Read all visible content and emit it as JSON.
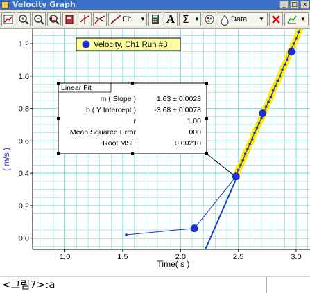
{
  "window": {
    "title": "Velocity Graph"
  },
  "toolbar": {
    "fit_label": "Fit",
    "data_label": "Data",
    "text_tool_label": "A",
    "stats_label": "Σ"
  },
  "legend": {
    "label": "Velocity, Ch1 Run #3"
  },
  "fit_box": {
    "title": "Linear Fit",
    "rows": [
      {
        "label": "m ( Slope )",
        "value": "1.63 ± 0.0028"
      },
      {
        "label": "b ( Y Intercept )",
        "value": "-3.68 ± 0.0078"
      },
      {
        "label": "r",
        "value": "1.00"
      },
      {
        "label": "Mean Squared Error",
        "value": "000"
      },
      {
        "label": "Root MSE",
        "value": "0.00210"
      }
    ]
  },
  "caption": "<그림7>:a",
  "colors": {
    "grid": "#7fe0e0",
    "series": "#1f2fd6",
    "fit_line": "#1a3bd0",
    "highlight": "#ffee00"
  },
  "chart_data": {
    "type": "scatter",
    "title": "",
    "xlabel": "Time( s )",
    "ylabel": "( m/s )",
    "xlim": [
      0.72,
      3.12
    ],
    "ylim": [
      -0.07,
      1.29
    ],
    "xticks": [
      "1.0",
      "1.5",
      "2.0",
      "2.5",
      "3.0"
    ],
    "yticks": [
      "0.0",
      "0.2",
      "0.4",
      "0.6",
      "0.8",
      "1.0",
      "1.2"
    ],
    "grid": true,
    "legend_position": "top-center",
    "series": [
      {
        "name": "Velocity, Ch1 Run #3",
        "x": [
          1.53,
          2.12,
          2.48,
          2.5,
          2.52,
          2.54,
          2.56,
          2.58,
          2.6,
          2.62,
          2.64,
          2.66,
          2.68,
          2.7,
          2.72,
          2.74,
          2.76,
          2.78,
          2.8,
          2.82,
          2.84,
          2.86,
          2.88,
          2.9,
          2.92,
          2.94,
          2.96,
          2.98,
          3.0,
          3.02,
          3.04,
          3.06
        ],
        "y": [
          0.02,
          0.06,
          0.38,
          0.42,
          0.45,
          0.48,
          0.52,
          0.55,
          0.58,
          0.61,
          0.65,
          0.68,
          0.71,
          0.74,
          0.77,
          0.81,
          0.84,
          0.87,
          0.91,
          0.94,
          0.97,
          1.0,
          1.04,
          1.07,
          1.1,
          1.14,
          1.17,
          1.2,
          1.23,
          1.27,
          1.3,
          1.33
        ]
      }
    ],
    "marked_points": [
      {
        "x": 2.12,
        "y": 0.06
      },
      {
        "x": 2.48,
        "y": 0.38
      },
      {
        "x": 2.71,
        "y": 0.77
      },
      {
        "x": 2.96,
        "y": 1.15
      }
    ],
    "fit": {
      "slope": 1.63,
      "intercept": -3.68,
      "x_from": 2.48,
      "x_to": 3.06
    }
  }
}
